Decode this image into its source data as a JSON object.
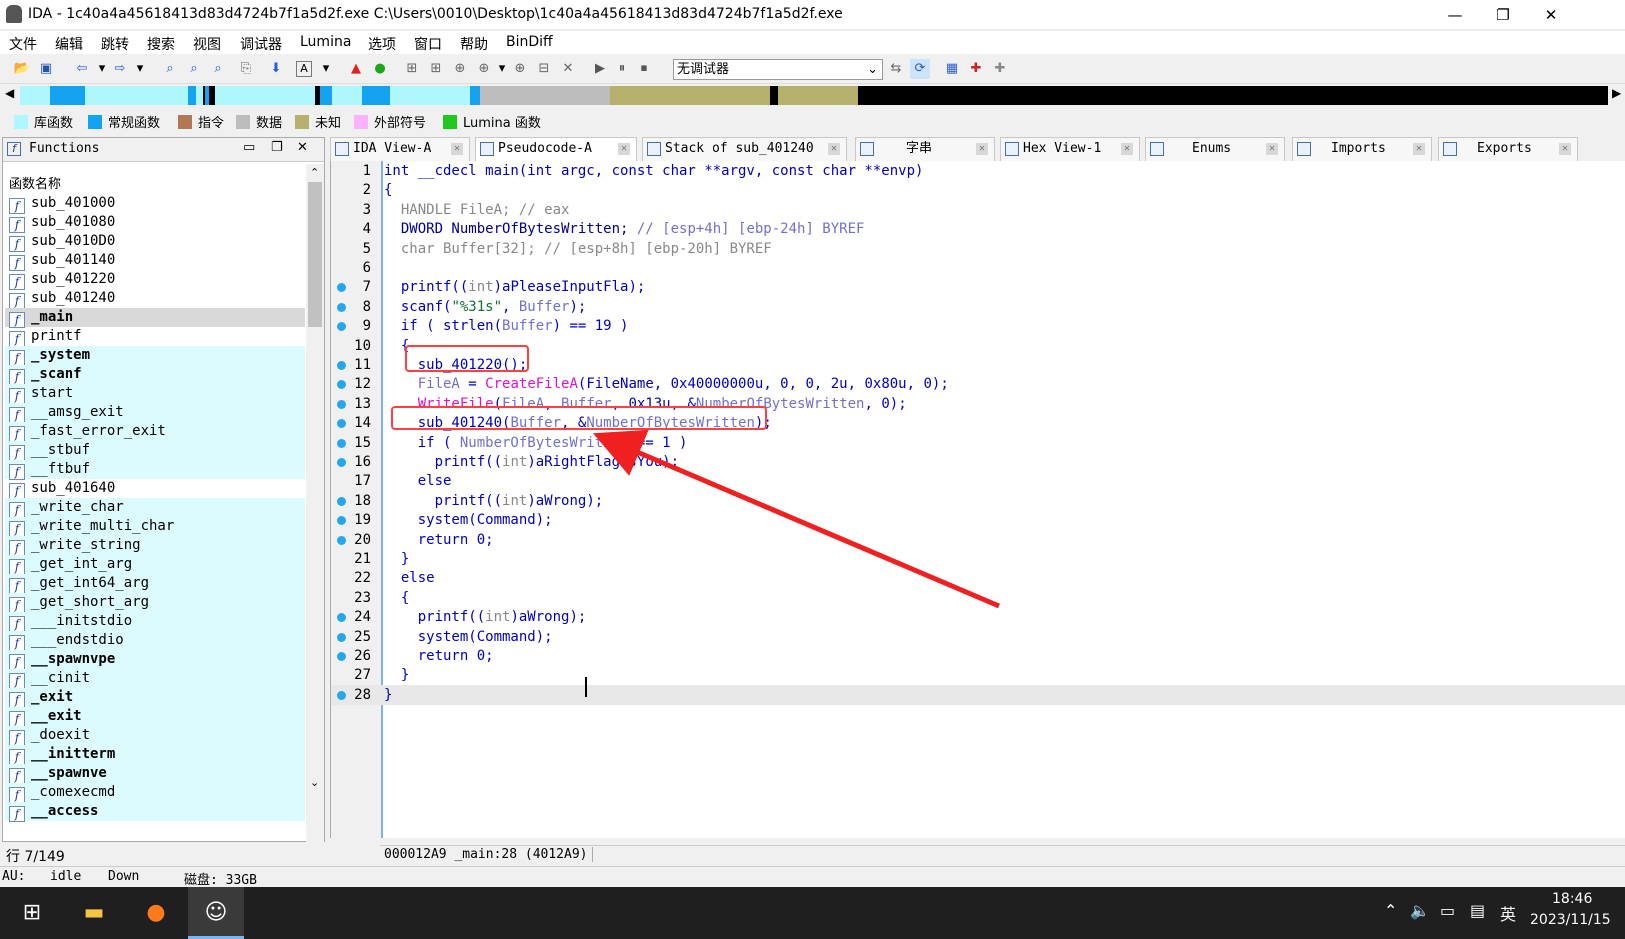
{
  "window": {
    "title": "IDA - 1c40a4a45618413d83d4724b7f1a5d2f.exe C:\\Users\\0010\\Desktop\\1c40a4a45618413d83d4724b7f1a5d2f.exe",
    "controls": {
      "minimize": "—",
      "maximize": "❐",
      "close": "✕"
    }
  },
  "menu": [
    "文件",
    "编辑",
    "跳转",
    "搜索",
    "视图",
    "调试器",
    "Lumina",
    "选项",
    "窗口",
    "帮助",
    "BinDiff"
  ],
  "toolbar": {
    "debugger_select": "无调试器"
  },
  "legend": [
    {
      "label": "库函数",
      "color": "#aef7ff"
    },
    {
      "label": "常规函数",
      "color": "#13a3f0"
    },
    {
      "label": "指令",
      "color": "#b07855"
    },
    {
      "label": "数据",
      "color": "#bdbdbd"
    },
    {
      "label": "未知",
      "color": "#b5b06c"
    },
    {
      "label": "外部符号",
      "color": "#ffb1ff"
    },
    {
      "label": "Lumina 函数",
      "color": "#1ec81e"
    }
  ],
  "functions_panel": {
    "title": "Functions",
    "column_header": "函数名称",
    "items": [
      {
        "name": "sub_401000",
        "kind": "regular"
      },
      {
        "name": "sub_401080",
        "kind": "regular"
      },
      {
        "name": "sub_4010D0",
        "kind": "regular"
      },
      {
        "name": "sub_401140",
        "kind": "regular"
      },
      {
        "name": "sub_401220",
        "kind": "regular"
      },
      {
        "name": "sub_401240",
        "kind": "regular"
      },
      {
        "name": "_main",
        "kind": "selected"
      },
      {
        "name": "printf",
        "kind": "regular"
      },
      {
        "name": "_system",
        "kind": "lib-bold"
      },
      {
        "name": "_scanf",
        "kind": "lib-bold"
      },
      {
        "name": "start",
        "kind": "lib"
      },
      {
        "name": "__amsg_exit",
        "kind": "lib"
      },
      {
        "name": "_fast_error_exit",
        "kind": "lib"
      },
      {
        "name": "__stbuf",
        "kind": "lib"
      },
      {
        "name": "__ftbuf",
        "kind": "lib"
      },
      {
        "name": "sub_401640",
        "kind": "regular"
      },
      {
        "name": "_write_char",
        "kind": "lib"
      },
      {
        "name": "_write_multi_char",
        "kind": "lib"
      },
      {
        "name": "_write_string",
        "kind": "lib"
      },
      {
        "name": "_get_int_arg",
        "kind": "lib"
      },
      {
        "name": "_get_int64_arg",
        "kind": "lib"
      },
      {
        "name": "_get_short_arg",
        "kind": "lib"
      },
      {
        "name": "___initstdio",
        "kind": "lib"
      },
      {
        "name": "___endstdio",
        "kind": "lib"
      },
      {
        "name": "__spawnvpe",
        "kind": "lib-bold"
      },
      {
        "name": "__cinit",
        "kind": "lib"
      },
      {
        "name": "_exit",
        "kind": "lib-bold"
      },
      {
        "name": "__exit",
        "kind": "lib-bold"
      },
      {
        "name": "_doexit",
        "kind": "lib"
      },
      {
        "name": "__initterm",
        "kind": "lib-bold"
      },
      {
        "name": "__spawnve",
        "kind": "lib-bold"
      },
      {
        "name": "_comexecmd",
        "kind": "lib"
      },
      {
        "name": "__access",
        "kind": "lib-bold"
      }
    ],
    "row_info": "行 7/149"
  },
  "tabs": [
    {
      "label": "IDA View-A",
      "active": false
    },
    {
      "label": "Pseudocode-A",
      "active": true
    },
    {
      "label": "Stack of sub_401240",
      "active": false
    },
    {
      "label": "字串",
      "active": false
    },
    {
      "label": "Hex View-1",
      "active": false
    },
    {
      "label": "Enums",
      "active": false
    },
    {
      "label": "Imports",
      "active": false
    },
    {
      "label": "Exports",
      "active": false
    }
  ],
  "code_lines": [
    {
      "n": "1",
      "dot": false,
      "html": "int __cdecl main(int argc, const char **argv, const char **envp)"
    },
    {
      "n": "2",
      "dot": false,
      "html": "{"
    },
    {
      "n": "3",
      "dot": false,
      "html": "  <span class='g'>HANDLE FileA; // eax</span>"
    },
    {
      "n": "4",
      "dot": false,
      "html": "  <span class='k'>DWORD NumberOfBytesWritten;</span> <span class='gb'>// [esp+4h] [ebp-24h] BYREF</span>"
    },
    {
      "n": "5",
      "dot": false,
      "html": "  <span class='g'>char Buffer[32]; // [esp+8h] [ebp-20h] BYREF</span>"
    },
    {
      "n": "6",
      "dot": false,
      "html": ""
    },
    {
      "n": "7",
      "dot": true,
      "html": "  printf((<span class='g'>int</span>)aPleaseInputFla);"
    },
    {
      "n": "8",
      "dot": true,
      "html": "  scanf(<span class='s'>\"%31s\"</span>, <span class='gb'>Buffer</span>);"
    },
    {
      "n": "9",
      "dot": true,
      "html": "  if ( strlen(<span class='gb'>Buffer</span>) == 19 )"
    },
    {
      "n": "10",
      "dot": false,
      "html": "  {"
    },
    {
      "n": "11",
      "dot": true,
      "html": "    sub_401220();"
    },
    {
      "n": "12",
      "dot": true,
      "html": "    <span class='gb'>FileA</span> = <span class='p'>CreateFileA</span>(FileName, 0x40000000u, 0, 0, 2u, 0x80u, 0);"
    },
    {
      "n": "13",
      "dot": true,
      "html": "    <span class='p'>WriteFile</span>(<span class='gb'>FileA</span>, <span class='gb'>Buffer</span>, 0x13u, &amp;<span class='gb'>NumberOfBytesWritten</span>, 0);"
    },
    {
      "n": "14",
      "dot": true,
      "html": "    sub_401240(<span class='gb'>Buffer</span>, &amp;<span class='gb'>NumberOfBytesWritten</span>);"
    },
    {
      "n": "15",
      "dot": true,
      "html": "    if ( <span class='gb'>NumberOfBytesWritten</span> == 1 )"
    },
    {
      "n": "16",
      "dot": true,
      "html": "      printf((<span class='g'>int</span>)aRightFlagIsYou);"
    },
    {
      "n": "17",
      "dot": false,
      "html": "    else"
    },
    {
      "n": "18",
      "dot": true,
      "html": "      printf((<span class='g'>int</span>)aWrong);"
    },
    {
      "n": "19",
      "dot": true,
      "html": "    system(Command);"
    },
    {
      "n": "20",
      "dot": true,
      "html": "    return 0;"
    },
    {
      "n": "21",
      "dot": false,
      "html": "  }"
    },
    {
      "n": "22",
      "dot": false,
      "html": "  else"
    },
    {
      "n": "23",
      "dot": false,
      "html": "  {"
    },
    {
      "n": "24",
      "dot": true,
      "html": "    printf((<span class='g'>int</span>)aWrong);"
    },
    {
      "n": "25",
      "dot": true,
      "html": "    system(Command);"
    },
    {
      "n": "26",
      "dot": true,
      "html": "    return 0;"
    },
    {
      "n": "27",
      "dot": false,
      "html": "  }"
    },
    {
      "n": "28",
      "dot": true,
      "html": "}"
    }
  ],
  "status_line": "000012A9 _main:28 (4012A9)",
  "au_bar": {
    "au": "AU:",
    "state": "idle",
    "direction": "Down",
    "disk": "磁盘: 33GB"
  },
  "taskbar": {
    "time": "18:46",
    "date": "2023/11/15",
    "ime": "英"
  }
}
